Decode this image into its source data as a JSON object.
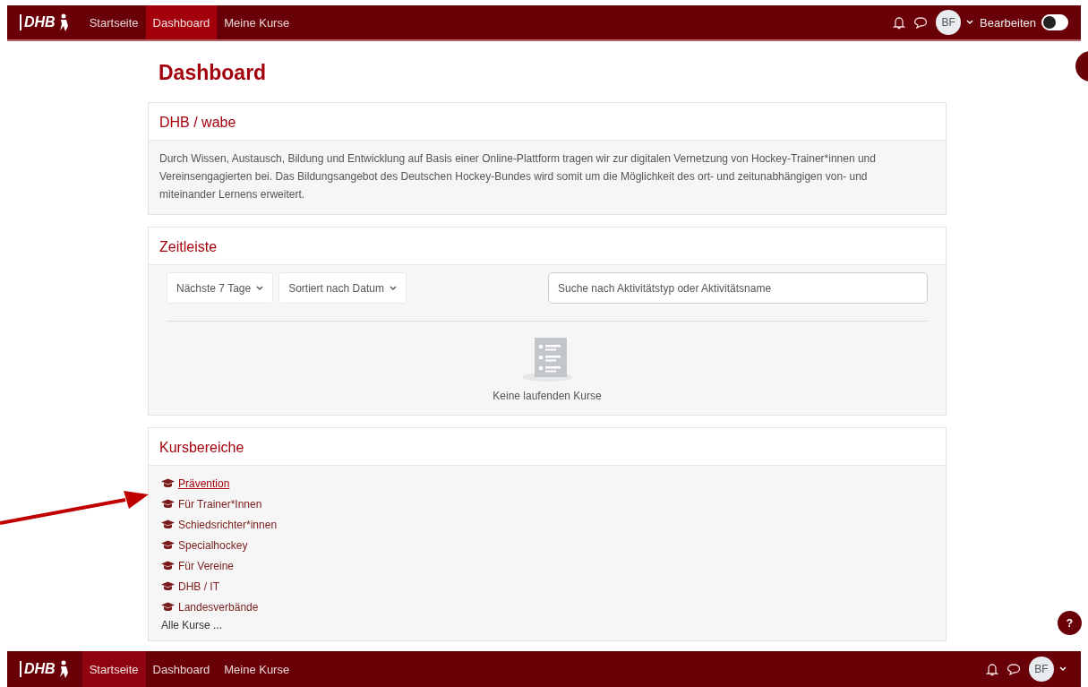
{
  "top_nav": {
    "logo": "DHB",
    "items": [
      {
        "label": "Startseite",
        "selected": false
      },
      {
        "label": "Dashboard",
        "selected": true
      },
      {
        "label": "Meine Kurse",
        "selected": false
      }
    ],
    "avatar": "BF",
    "edit_label": "Bearbeiten",
    "edit_on": false
  },
  "page_title": "Dashboard",
  "intro_block": {
    "title": "DHB / wabe",
    "text": "Durch Wissen, Austausch, Bildung und Entwicklung auf Basis einer Online-Plattform tragen wir zur digitalen Vernetzung von Hockey-Trainer*innen und Vereinsengagierten bei. Das Bildungsangebot des Deutschen Hockey-Bundes wird somit um die Möglichkeit des ort- und zeitunabhängigen von- und miteinander Lernens erweitert."
  },
  "timeline": {
    "title": "Zeitleiste",
    "filters": [
      "Nächste 7 Tage",
      "Sortiert nach Datum"
    ],
    "search": {
      "placeholder": "Suche nach Aktivitätstyp oder Aktivitätsname"
    },
    "empty_message": "Keine laufenden Kurse"
  },
  "course_areas": {
    "title": "Kursbereiche",
    "items": [
      {
        "label": "Prävention",
        "hovered": true
      },
      {
        "label": "Für Trainer*Innen",
        "hovered": false
      },
      {
        "label": "Schiedsrichter*innen",
        "hovered": false
      },
      {
        "label": "Specialhockey",
        "hovered": false
      },
      {
        "label": "Für Vereine",
        "hovered": false
      },
      {
        "label": "DHB / IT",
        "hovered": false
      },
      {
        "label": "Landesverbände",
        "hovered": false
      }
    ],
    "all_link": "Alle Kurse ..."
  },
  "annotation": {
    "kind": "arrow"
  },
  "help_button": "?",
  "bottom_nav": {
    "logo": "DHB",
    "items": [
      {
        "label": "Startseite",
        "selected": true
      },
      {
        "label": "Dashboard",
        "selected": false
      },
      {
        "label": "Meine Kurse",
        "selected": false
      }
    ],
    "avatar": "BF"
  }
}
